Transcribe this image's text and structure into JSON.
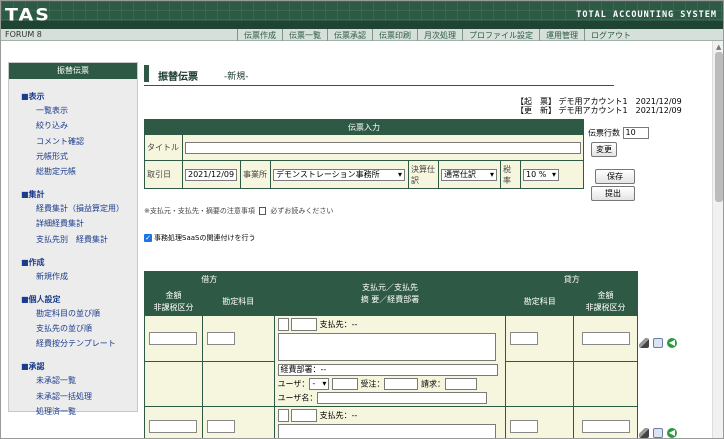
{
  "header": {
    "logo": "TAS",
    "system_title": "TOTAL ACCOUNTING SYSTEM"
  },
  "menubar": {
    "forum": "FORUM 8",
    "items": [
      "伝票作成",
      "伝票一覧",
      "伝票承認",
      "伝票印刷",
      "月次処理",
      "プロファイル設定",
      "運用管理",
      "ログアウト"
    ]
  },
  "sidebar": {
    "title": "振替伝票",
    "groups": [
      {
        "head": "■表示",
        "items": [
          "一覧表示",
          "絞り込み",
          "コメント確認",
          "元帳形式",
          "総勘定元帳"
        ]
      },
      {
        "head": "■集計",
        "items": [
          "経費集計（損益算定用）",
          "詳細経費集計",
          "支払先別　経費集計"
        ]
      },
      {
        "head": "■作成",
        "items": [
          "新規作成"
        ]
      },
      {
        "head": "■個人設定",
        "items": [
          "勘定科目の並び順",
          "支払先の並び順",
          "経費按分テンプレート"
        ]
      },
      {
        "head": "■承認",
        "items": [
          "未承認一覧",
          "未承認一括処理",
          "処理済一覧"
        ]
      }
    ]
  },
  "page": {
    "title": "振替伝票",
    "subtitle": "-新規-"
  },
  "meta": {
    "created": "【起　票】 デモ用アカウント1　2021/12/09",
    "updated": "【更　新】 デモ用アカウント1　2021/12/09"
  },
  "entry": {
    "header": "伝票入力",
    "title_label": "タイトル",
    "title_value": "",
    "date_label": "取引日",
    "date_value": "2021/12/09",
    "office_label": "事業所",
    "office_value": "デモンストレーション事務所",
    "settle_label": "決算仕訳",
    "settle_value": "通常仕訳",
    "tax_label": "税率",
    "tax_value": "10 %"
  },
  "side_controls": {
    "lines_label": "伝票行数",
    "lines_value": "10",
    "change": "変更",
    "save": "保存",
    "submit": "提出"
  },
  "note": "※支払元・支払先・摘要の注意事項",
  "note_link": "必ずお読みください",
  "saas_checkbox": {
    "checked": true,
    "label": "事務処理SaaSの関連付けを行う"
  },
  "journal": {
    "debit": "借方",
    "credit": "貸方",
    "amount": "金額",
    "taxfree": "非課税区分",
    "account": "勘定科目",
    "center_line1": "支払元／支払先",
    "center_line2": "摘 要／経費部署",
    "payee_label": "支払先：--",
    "dept_label": "経費部署：--",
    "user_label": "ユーザ：",
    "user_sel": "-",
    "order_label": "受注：",
    "invoice_label": "請求：",
    "username_label": "ユーザ名："
  },
  "colors": {
    "brand": "#2e5a45",
    "cell_bg": "#f6f6de"
  }
}
